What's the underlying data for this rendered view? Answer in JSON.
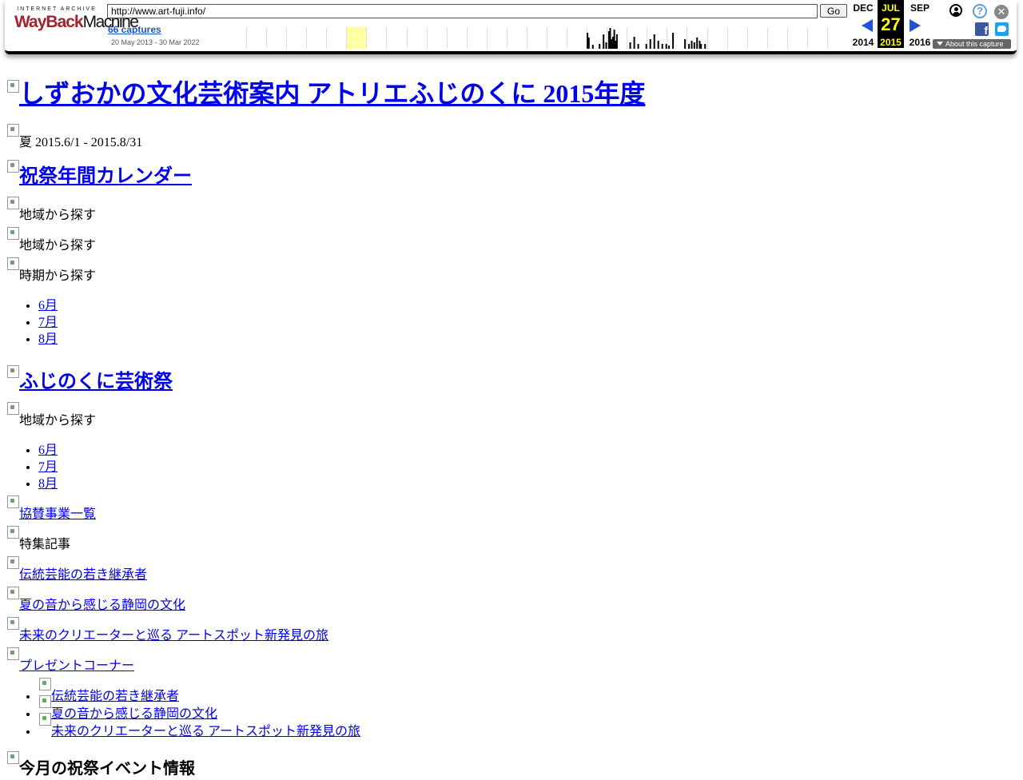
{
  "toolbar": {
    "logo_top": "INTERNET ARCHIVE",
    "logo_main_a": "WayBack",
    "logo_main_b": "Machine",
    "url_value": "http://www.art-fuji.info/",
    "go_label": "Go",
    "captures_label": "66 captures",
    "range_label": "20 May 2013 - 30 Mar 2022",
    "calendar": {
      "prev": {
        "month": "DEC",
        "year": "2014"
      },
      "current": {
        "month": "JUL",
        "day": "27",
        "year": "2015"
      },
      "next": {
        "month": "SEP",
        "year": "2016"
      }
    },
    "help_glyph": "?",
    "close_glyph": "✕",
    "fb_glyph": "f",
    "about_label": "About this capture",
    "accent_color": "#2153d2",
    "current_bg": "#000000",
    "current_fg": "#ffff00",
    "icons": [
      "user-icon",
      "help-icon",
      "close-icon",
      "facebook-icon",
      "twitter-icon"
    ]
  },
  "sparkline": {
    "highlight_start_index": 4,
    "highlight_span": 2,
    "years": 30,
    "bars": [
      [
        1,
        0,
        20
      ],
      [
        1,
        1,
        14
      ],
      [
        1,
        4,
        5
      ],
      [
        1,
        9,
        6
      ],
      [
        1,
        12,
        18
      ],
      [
        1,
        14,
        8
      ],
      [
        1,
        16,
        22
      ],
      [
        1,
        17,
        26
      ],
      [
        1,
        18,
        12
      ],
      [
        1,
        19,
        15
      ],
      [
        1,
        20,
        24
      ],
      [
        1,
        21,
        10
      ],
      [
        1,
        22,
        18
      ],
      [
        2,
        2,
        8
      ],
      [
        2,
        5,
        15
      ],
      [
        2,
        8,
        6
      ],
      [
        2,
        14,
        6
      ],
      [
        2,
        17,
        12
      ],
      [
        2,
        20,
        18
      ],
      [
        2,
        23,
        10
      ],
      [
        2,
        26,
        6
      ],
      [
        2,
        29,
        6
      ],
      [
        3,
        1,
        4
      ],
      [
        3,
        4,
        20
      ],
      [
        3,
        13,
        12
      ],
      [
        3,
        16,
        6
      ],
      [
        3,
        18,
        10
      ],
      [
        3,
        20,
        8
      ],
      [
        3,
        22,
        14
      ],
      [
        3,
        24,
        10
      ],
      [
        3,
        25,
        6
      ],
      [
        3,
        28,
        6
      ]
    ]
  },
  "page": {
    "title": "しずおかの文化芸術案内 アトリエふじのくに 2015年度",
    "season": "夏 2015.6/1 - 2015.8/31",
    "calendar_heading": "祝祭年間カレンダー",
    "search_region_1": "地域から探す",
    "search_region_2": "地域から探す",
    "search_period": "時期から探す",
    "months_1": [
      "6月",
      "7月",
      "8月"
    ],
    "festival_heading": "ふじのくに芸術祭",
    "search_region_3": "地域から探す",
    "months_2": [
      "6月",
      "7月",
      "8月"
    ],
    "sponsor_link": "協賛事業一覧",
    "feature_label": "特集記事",
    "feature_1": "伝統芸能の若き継承者",
    "feature_2": "夏の音から感じる静岡の文化",
    "feature_3": "未来のクリエーターと巡る アートスポット新発見の旅",
    "present_link": "プレゼントコーナー",
    "feature_list": [
      "伝統芸能の若き継承者",
      "夏の音から感じる静岡の文化",
      "未来のクリエーターと巡る アートスポット新発見の旅"
    ],
    "event_heading": "今月の祝祭イベント情報"
  }
}
